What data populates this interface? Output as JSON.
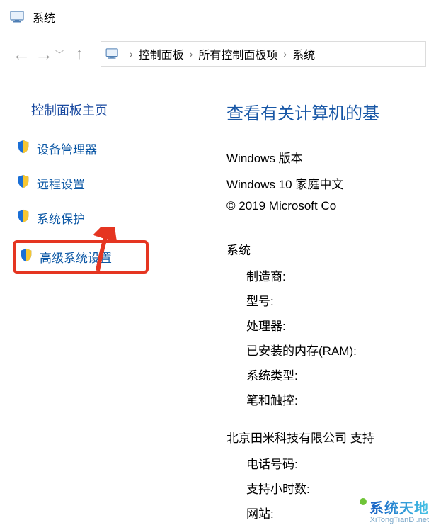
{
  "window": {
    "title": "系统"
  },
  "nav": {
    "breadcrumb": [
      "控制面板",
      "所有控制面板项",
      "系统"
    ]
  },
  "sidebar": {
    "home_label": "控制面板主页",
    "items": [
      {
        "label": "设备管理器",
        "shield": true
      },
      {
        "label": "远程设置",
        "shield": true
      },
      {
        "label": "系统保护",
        "shield": true
      },
      {
        "label": "高级系统设置",
        "shield": true,
        "highlight": true
      }
    ]
  },
  "main": {
    "heading": "查看有关计算机的基",
    "edition_section": "Windows 版本",
    "edition_line1": "Windows 10 家庭中文",
    "edition_line2": "© 2019 Microsoft Co",
    "system_section": "系统",
    "system_rows": {
      "manufacturer": "制造商:",
      "model": "型号:",
      "processor": "处理器:",
      "ram": "已安装的内存(RAM):",
      "system_type": "系统类型:",
      "pen_touch": "笔和触控:"
    },
    "support_heading": "北京田米科技有限公司 支持",
    "support_rows": {
      "phone": "电话号码:",
      "hours": "支持小时数:",
      "website": "网站:"
    }
  },
  "watermark": {
    "line1": "系统天地",
    "line2": "XiTongTianDi.net"
  }
}
